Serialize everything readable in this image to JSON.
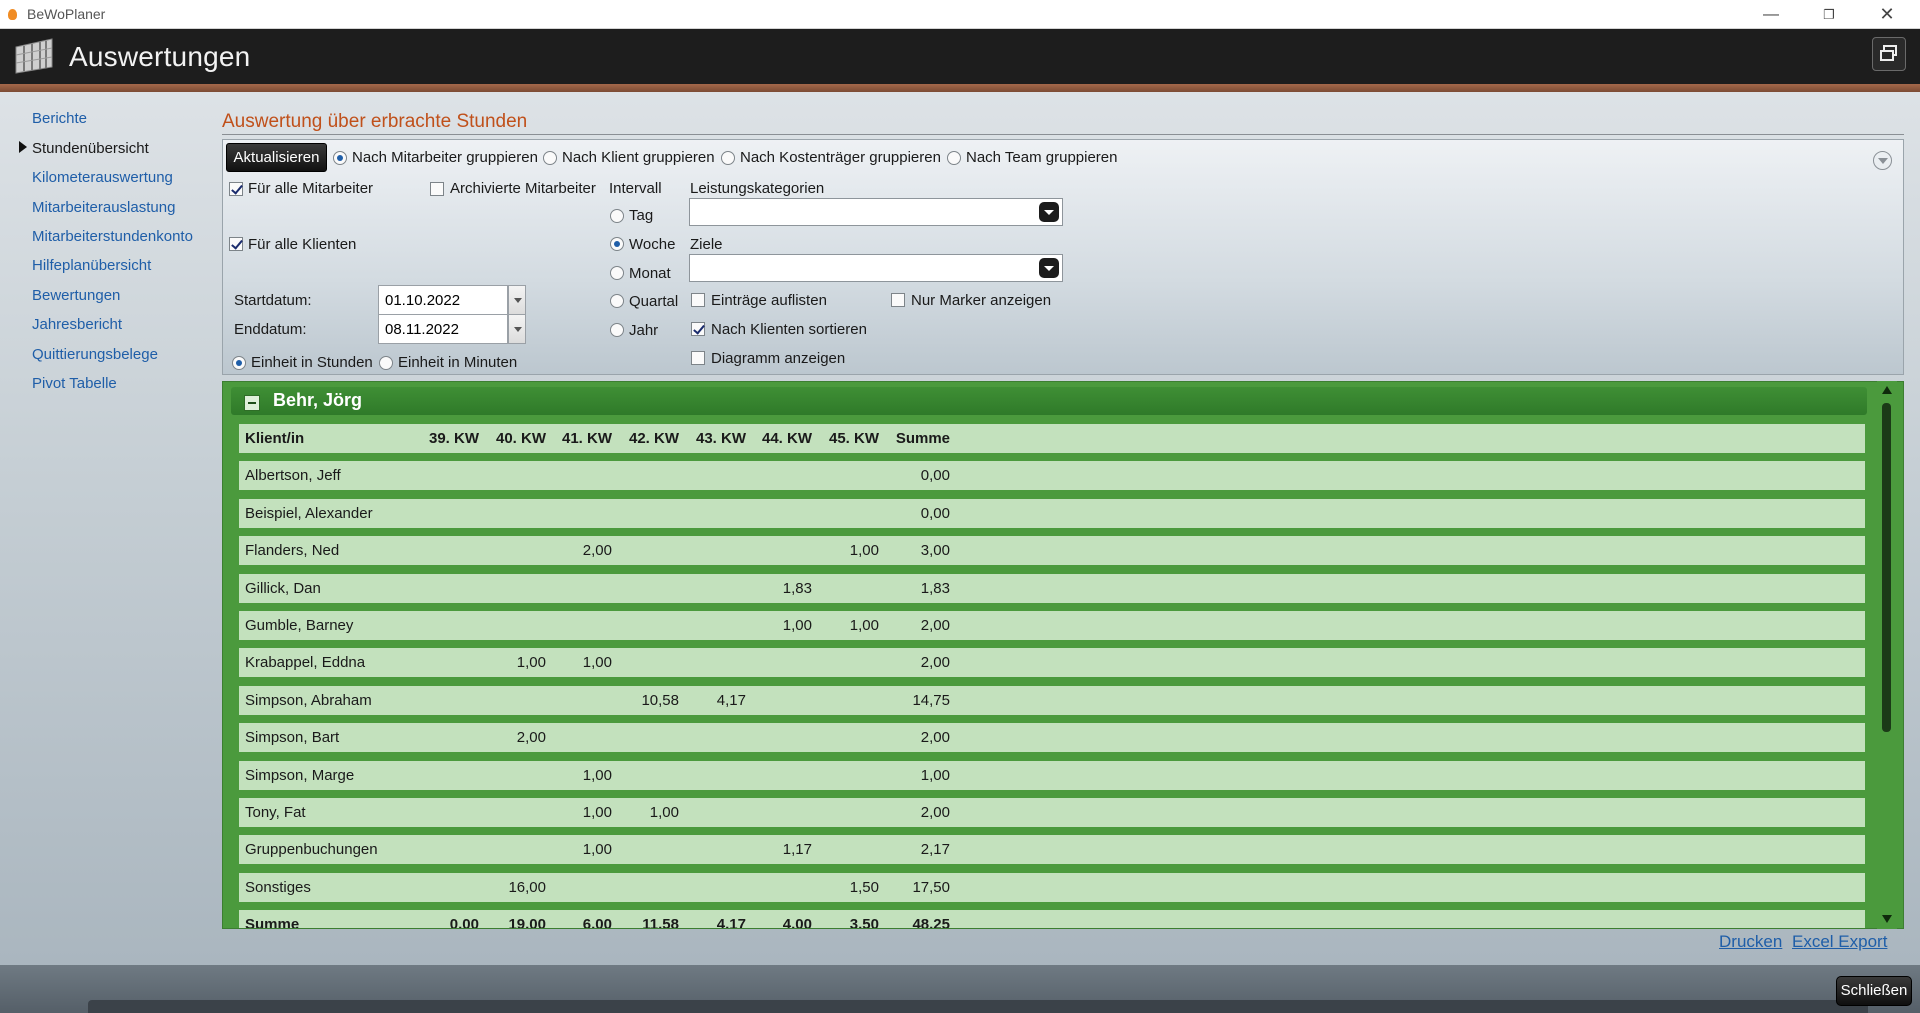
{
  "window": {
    "title": "BeWoPlaner"
  },
  "header": {
    "title": "Auswertungen"
  },
  "sidebar": {
    "items": [
      {
        "label": "Berichte",
        "active": false
      },
      {
        "label": "Stundenübersicht",
        "active": true
      },
      {
        "label": "Kilometerauswertung",
        "active": false
      },
      {
        "label": "Mitarbeiterauslastung",
        "active": false
      },
      {
        "label": "Mitarbeiterstundenkonto",
        "active": false
      },
      {
        "label": "Hilfeplanübersicht",
        "active": false
      },
      {
        "label": "Bewertungen",
        "active": false
      },
      {
        "label": "Jahresbericht",
        "active": false
      },
      {
        "label": "Quittierungsbelege",
        "active": false
      },
      {
        "label": "Pivot Tabelle",
        "active": false
      }
    ]
  },
  "panel": {
    "title": "Auswertung über erbrachte Stunden",
    "refresh_label": "Aktualisieren",
    "grouping": {
      "options": [
        "Nach Mitarbeiter gruppieren",
        "Nach Klient gruppieren",
        "Nach Kostenträger gruppieren",
        "Nach Team gruppieren"
      ],
      "selected": "Nach Mitarbeiter gruppieren"
    },
    "all_employees": {
      "label": "Für alle Mitarbeiter",
      "checked": true
    },
    "archived_employees": {
      "label": "Archivierte Mitarbeiter",
      "checked": false
    },
    "all_clients": {
      "label": "Für alle Klienten",
      "checked": true
    },
    "start_label": "Startdatum:",
    "start_value": "01.10.2022",
    "end_label": "Enddatum:",
    "end_value": "08.11.2022",
    "unit": {
      "hours_label": "Einheit in Stunden",
      "minutes_label": "Einheit in Minuten",
      "selected": "hours"
    },
    "interval": {
      "label": "Intervall",
      "options": [
        "Tag",
        "Woche",
        "Monat",
        "Quartal",
        "Jahr"
      ],
      "selected": "Woche"
    },
    "categories_label": "Leistungskategorien",
    "categories_value": "",
    "goals_label": "Ziele",
    "goals_value": "",
    "list_entries": {
      "label": "Einträge auflisten",
      "checked": false
    },
    "markers_only": {
      "label": "Nur Marker anzeigen",
      "checked": false
    },
    "sort_by_clients": {
      "label": "Nach Klienten sortieren",
      "checked": true
    },
    "show_chart": {
      "label": "Diagramm anzeigen",
      "checked": false
    }
  },
  "results": {
    "group_name": "Behr, Jörg",
    "columns": [
      "Klient/in",
      "39. KW",
      "40. KW",
      "41. KW",
      "42. KW",
      "43. KW",
      "44. KW",
      "45. KW",
      "Summe"
    ],
    "rows": [
      [
        "Albertson, Jeff",
        "",
        "",
        "",
        "",
        "",
        "",
        "",
        "0,00"
      ],
      [
        "Beispiel, Alexander",
        "",
        "",
        "",
        "",
        "",
        "",
        "",
        "0,00"
      ],
      [
        "Flanders, Ned",
        "",
        "",
        "2,00",
        "",
        "",
        "",
        "1,00",
        "3,00"
      ],
      [
        "Gillick, Dan",
        "",
        "",
        "",
        "",
        "",
        "1,83",
        "",
        "1,83"
      ],
      [
        "Gumble, Barney",
        "",
        "",
        "",
        "",
        "",
        "1,00",
        "1,00",
        "2,00"
      ],
      [
        "Krabappel, Eddna",
        "",
        "1,00",
        "1,00",
        "",
        "",
        "",
        "",
        "2,00"
      ],
      [
        "Simpson, Abraham",
        "",
        "",
        "",
        "10,58",
        "4,17",
        "",
        "",
        "14,75"
      ],
      [
        "Simpson, Bart",
        "",
        "2,00",
        "",
        "",
        "",
        "",
        "",
        "2,00"
      ],
      [
        "Simpson, Marge",
        "",
        "",
        "1,00",
        "",
        "",
        "",
        "",
        "1,00"
      ],
      [
        "Tony, Fat",
        "",
        "",
        "1,00",
        "1,00",
        "",
        "",
        "",
        "2,00"
      ],
      [
        "Gruppenbuchungen",
        "",
        "",
        "1,00",
        "",
        "",
        "1,17",
        "",
        "2,17"
      ],
      [
        "Sonstiges",
        "",
        "16,00",
        "",
        "",
        "",
        "",
        "1,50",
        "17,50"
      ]
    ],
    "sum_row": [
      "Summe",
      "0,00",
      "19,00",
      "6,00",
      "11,58",
      "4,17",
      "4,00",
      "3,50",
      "48,25"
    ]
  },
  "actions": {
    "print": "Drucken",
    "excel": "Excel Export",
    "close": "Schließen"
  }
}
